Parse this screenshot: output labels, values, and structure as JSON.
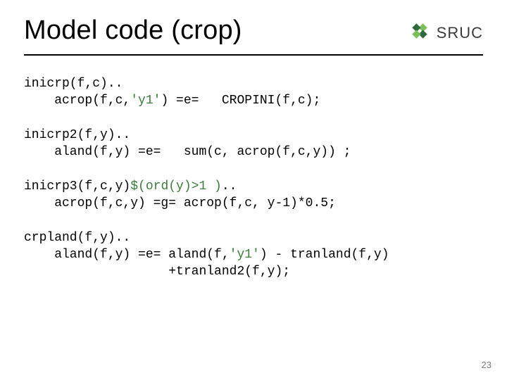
{
  "header": {
    "title": "Model code (crop)",
    "logo_text": "SRUC"
  },
  "code": {
    "b1_l1": "inicrp(f,c)..",
    "b1_l2a": "    acrop(f,c,",
    "b1_y1": "'y1'",
    "b1_l2b": ") =e=   CROPINI(f,c);",
    "b2_l1": "inicrp2(f,y)..",
    "b2_l2": "    aland(f,y) =e=   sum(c, acrop(f,c,y)) ;",
    "b3_l1a": "inicrp3(f,c,y)",
    "b3_cond": "$(ord(y)>1 )",
    "b3_l1b": "..",
    "b3_l2": "    acrop(f,c,y) =g= acrop(f,c, y-1)*0.5;",
    "b4_l1": "crpland(f,y)..",
    "b4_l2a": "    aland(f,y) =e= aland(f,",
    "b4_y1": "'y1'",
    "b4_l2b": ") - tranland(f,y)",
    "b4_l3": "                   +tranland2(f,y);"
  },
  "page_number": "23"
}
